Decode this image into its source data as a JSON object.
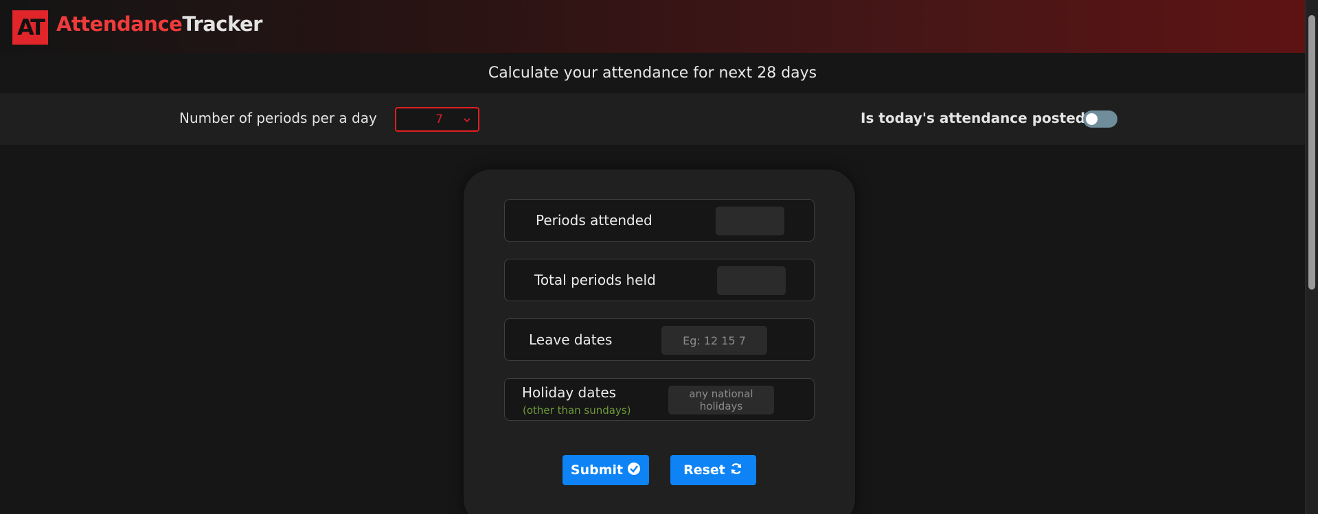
{
  "header": {
    "logo_text": "AT",
    "brand_part1": "Attendance",
    "brand_part2": "Tracker"
  },
  "subtitle": "Calculate your attendance for next 28 days",
  "settings": {
    "periods_label": "Number of periods per a day",
    "periods_value": "7",
    "posted_label": "Is today's attendance posted",
    "posted_toggle_on": false
  },
  "form": {
    "periods_attended_label": "Periods attended",
    "periods_attended_value": "",
    "total_periods_label": "Total periods held",
    "total_periods_value": "",
    "leave_dates_label": "Leave dates",
    "leave_dates_placeholder": "Eg: 12 15 7",
    "holiday_dates_label": "Holiday dates",
    "holiday_dates_sub": "(other than sundays)",
    "holiday_dates_placeholder": "any national holidays"
  },
  "buttons": {
    "submit_label": "Submit",
    "reset_label": "Reset"
  },
  "colors": {
    "accent_red": "#ef3b3b",
    "button_blue": "#0d83f5",
    "subtext_green": "#6e9a3a"
  }
}
